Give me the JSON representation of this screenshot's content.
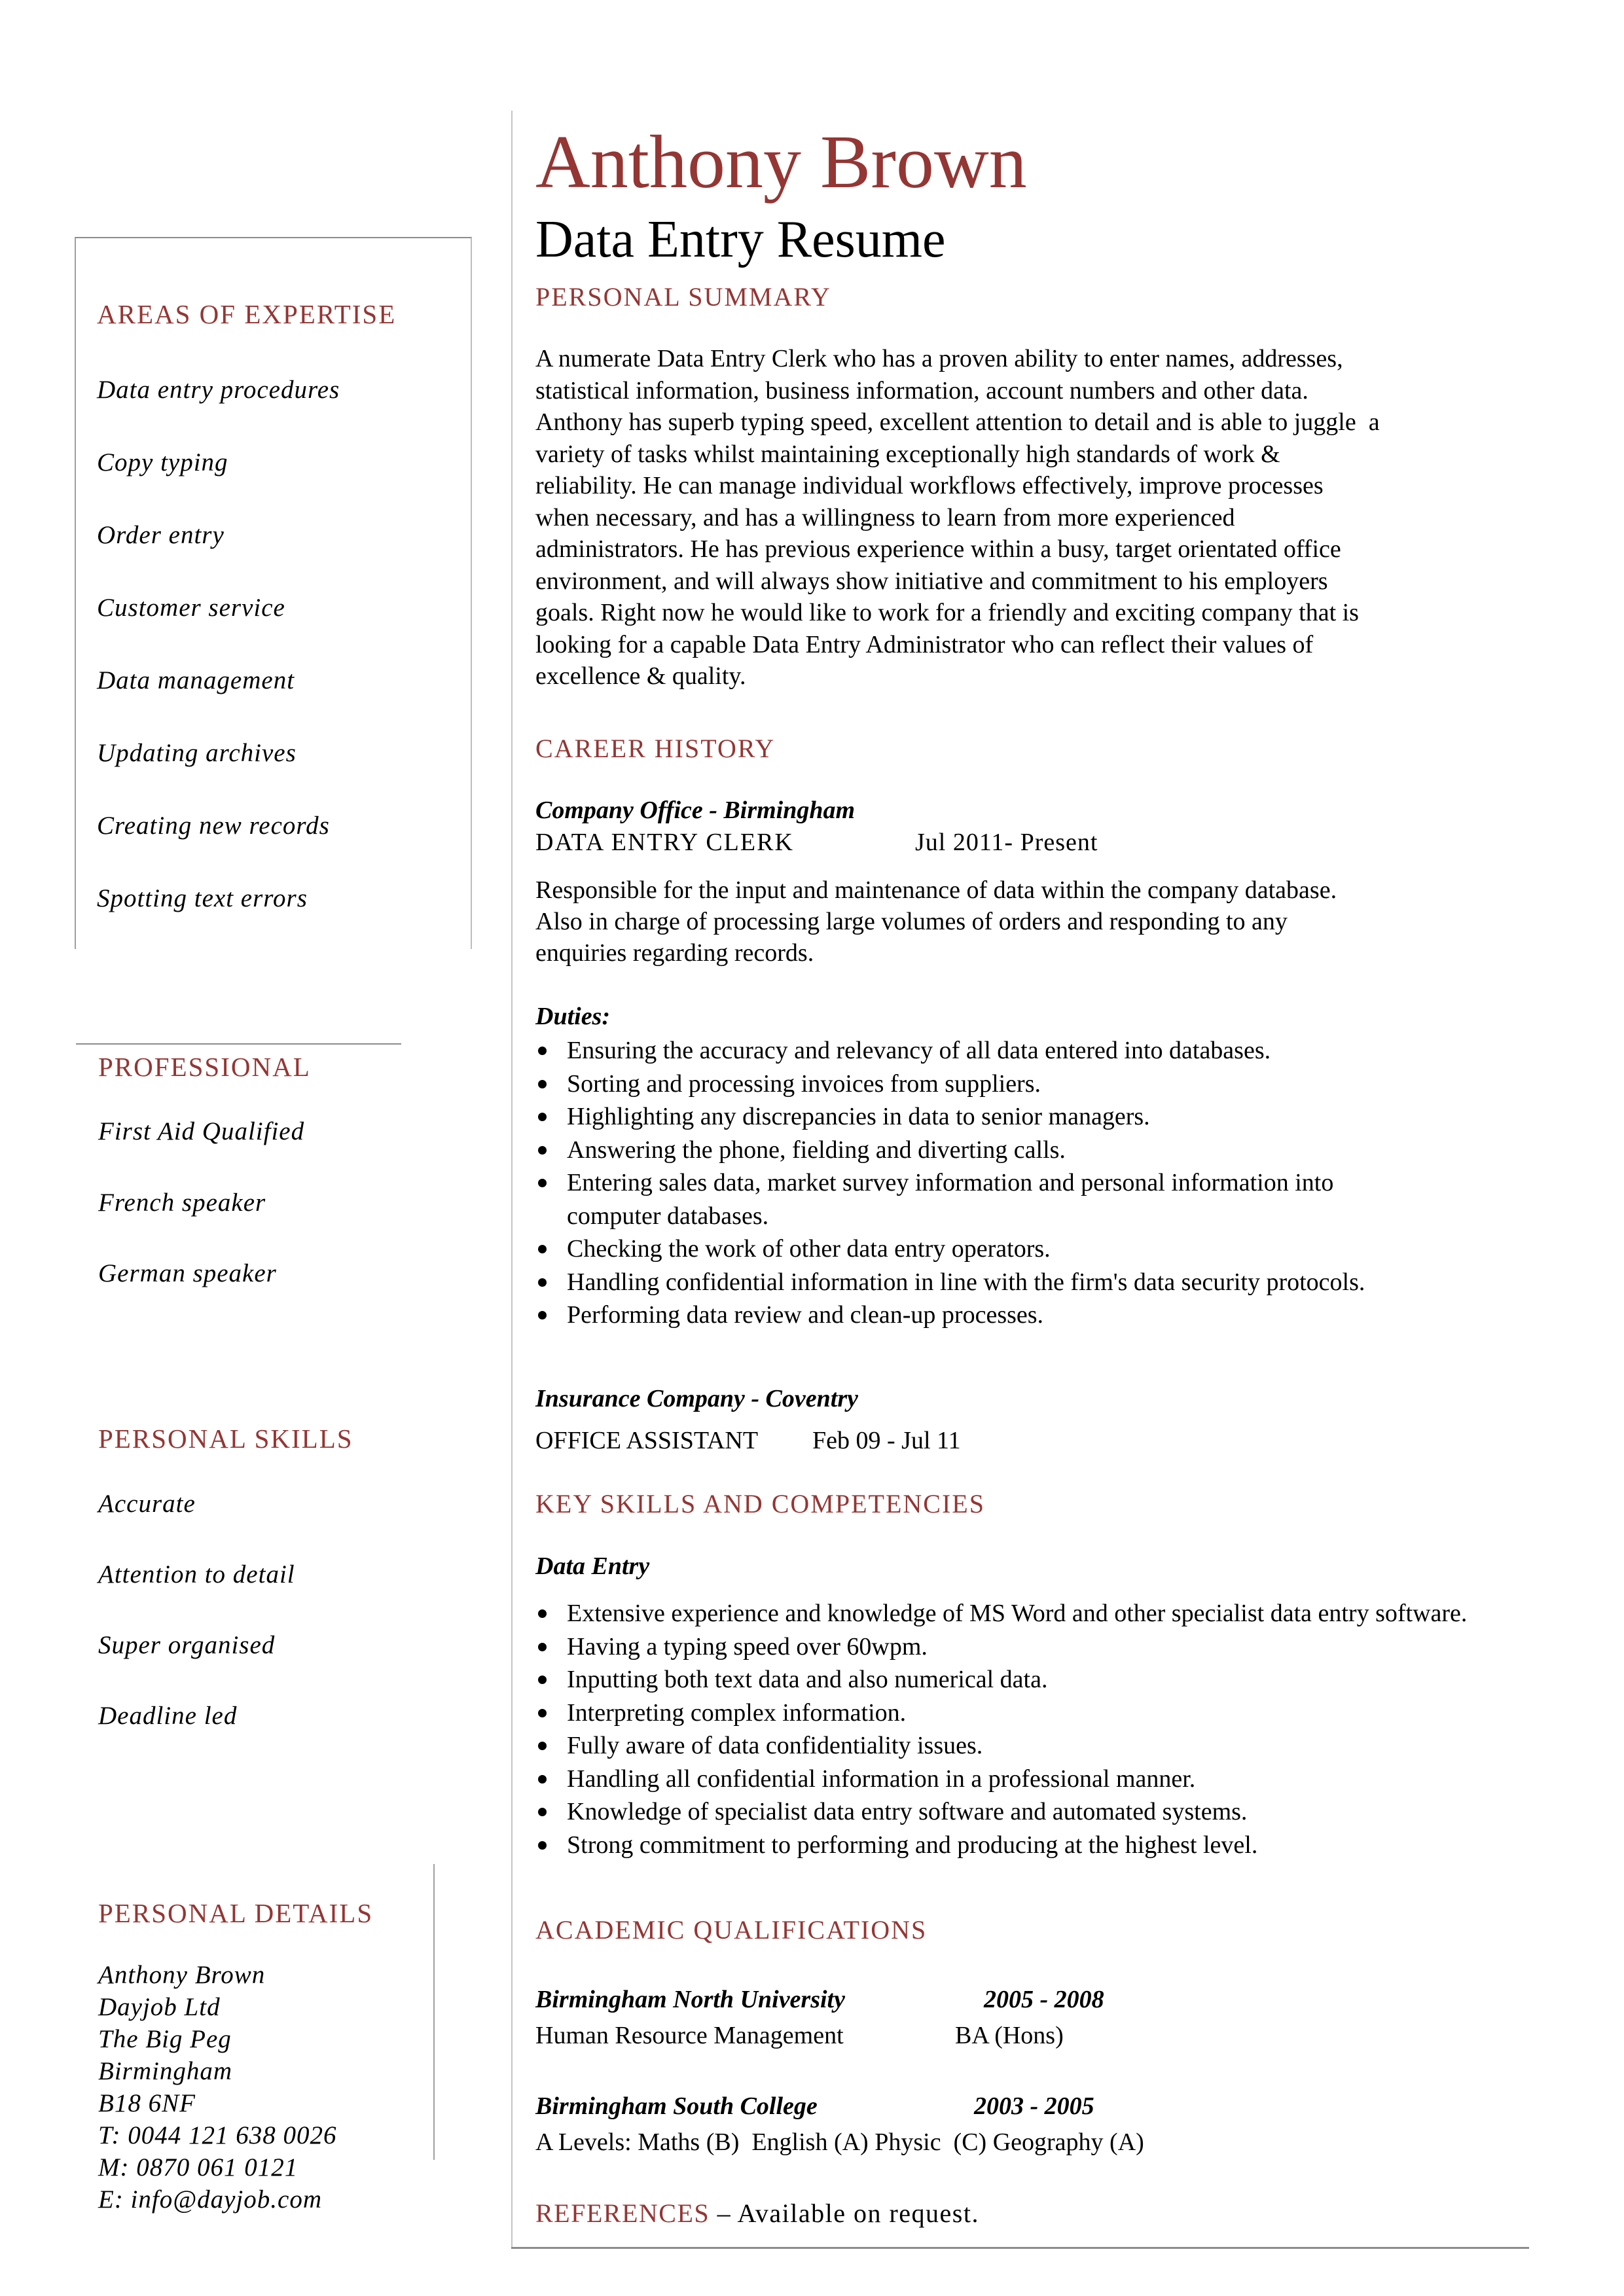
{
  "header": {
    "name": "Anthony Brown",
    "title": "Data Entry Resume"
  },
  "colors": {
    "accent": "#943634",
    "text": "#000000",
    "rule": "#8c8c8c"
  },
  "sidebar": {
    "expertise": {
      "heading": "AREAS OF EXPERTISE",
      "items": [
        "Data entry procedures",
        "Copy typing",
        "Order entry",
        "Customer service",
        "Data management",
        "Updating archives",
        "Creating new records",
        "Spotting text errors"
      ]
    },
    "professional": {
      "heading": "PROFESSIONAL",
      "items": [
        "First Aid Qualified",
        "French speaker",
        "German speaker"
      ]
    },
    "personal_skills": {
      "heading": "PERSONAL SKILLS",
      "items": [
        "Accurate",
        "Attention to detail",
        "Super organised",
        "Deadline led"
      ]
    },
    "personal_details": {
      "heading": "PERSONAL DETAILS",
      "lines": [
        "Anthony Brown",
        "Dayjob Ltd",
        "The Big Peg",
        "Birmingham",
        "B18 6NF",
        "T: 0044 121 638 0026",
        "M: 0870 061 0121",
        "E: info@dayjob.com"
      ]
    }
  },
  "main": {
    "summary": {
      "heading": "PERSONAL SUMMARY",
      "lines": [
        "A numerate Data Entry Clerk who has a proven ability to enter names, addresses,",
        "statistical information, business information, account numbers and other data.",
        "Anthony has superb typing speed, excellent attention to detail and is able to juggle  a",
        "variety of tasks whilst maintaining exceptionally high standards of work &",
        "reliability. He can manage individual workflows effectively, improve processes",
        "when necessary, and has a willingness to learn from more experienced",
        "administrators. He has previous experience within a busy, target orientated office",
        "environment, and will always show initiative and commitment to his employers",
        "goals. Right now he would like to work for a friendly and exciting company that is",
        "looking for a capable Data Entry Administrator who can reflect their values of",
        "excellence & quality."
      ]
    },
    "career": {
      "heading": "CAREER HISTORY",
      "jobs": [
        {
          "company": "Company Office - Birmingham",
          "role": "DATA ENTRY CLERK",
          "dates": "Jul 2011- Present",
          "description_lines": [
            "Responsible for the input and maintenance of data within the company database.",
            "Also in charge of processing large volumes of orders and responding to any",
            "enquiries regarding records."
          ],
          "duties_label": "Duties:",
          "duties": [
            "Ensuring the accuracy and relevancy of all data entered into databases.",
            "Sorting and processing invoices from suppliers.",
            "Highlighting any discrepancies in data to senior managers.",
            "Answering the phone, fielding and diverting calls.",
            "Entering sales data, market survey information and personal information into computer databases.",
            "Checking the work of other data entry operators.",
            "Handling confidential information in line with the firm's data security protocols.",
            "Performing data review and clean-up processes."
          ]
        },
        {
          "company": "Insurance Company - Coventry",
          "role": "OFFICE ASSISTANT",
          "dates": "Feb 09 - Jul 11"
        }
      ]
    },
    "skills": {
      "heading": "KEY SKILLS AND COMPETENCIES",
      "subheading": "Data Entry",
      "items": [
        "Extensive experience and knowledge of MS Word and other specialist data entry software.",
        "Having a typing speed over 60wpm.",
        "Inputting both text data and also numerical data.",
        "Interpreting complex information.",
        "Fully aware of data confidentiality issues.",
        "Handling all confidential information in a professional manner.",
        "Knowledge of specialist data entry software and automated systems.",
        "Strong commitment to performing and producing at the highest level."
      ]
    },
    "academic": {
      "heading": "ACADEMIC QUALIFICATIONS",
      "entries": [
        {
          "institution": "Birmingham North University",
          "years": "2005 - 2008",
          "detail": "Human Resource Management",
          "award": "BA (Hons)"
        },
        {
          "institution": "Birmingham South College",
          "years": "2003 - 2005",
          "detail": "A Levels: Maths (B)  English (A) Physic  (C) Geography (A)",
          "award": ""
        }
      ]
    },
    "references": {
      "heading": "REFERENCES",
      "text": " – Available on request."
    }
  }
}
